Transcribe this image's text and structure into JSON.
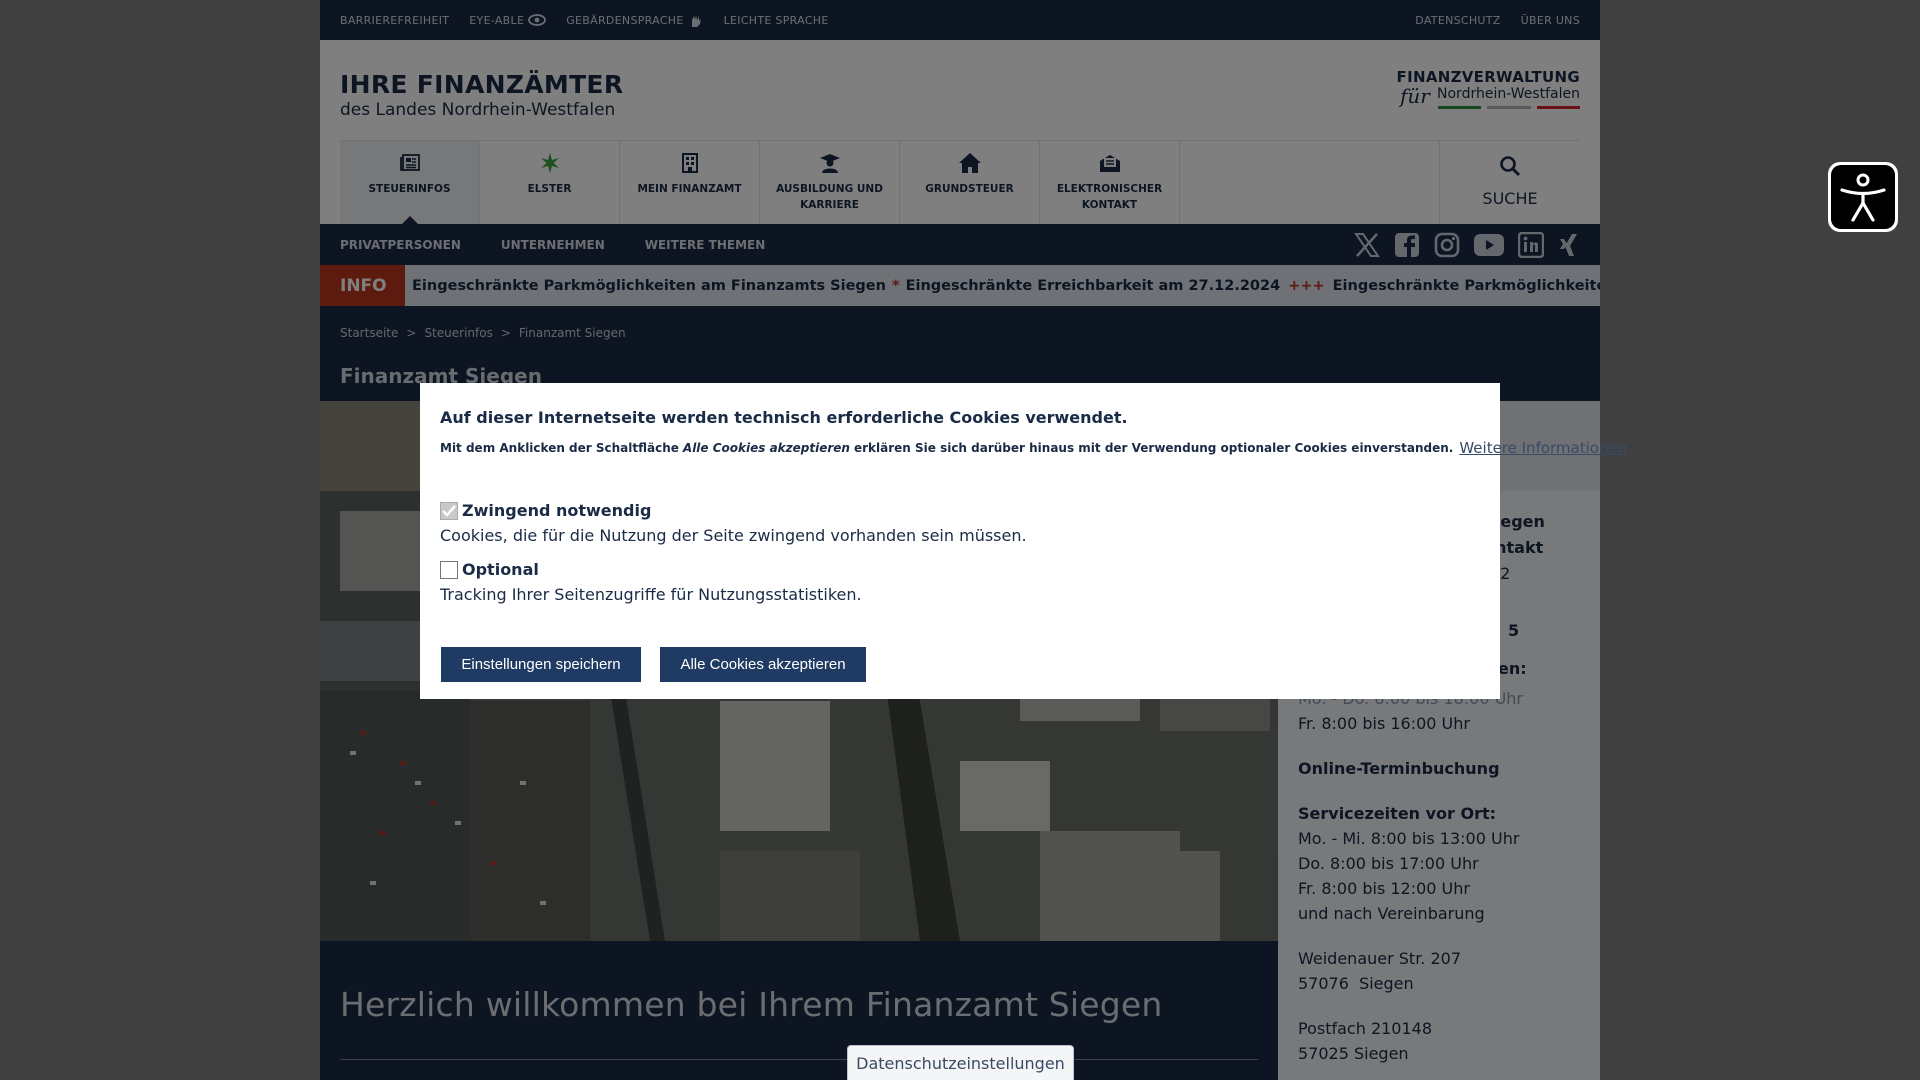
{
  "colors": {
    "navy": "#1a2b45",
    "info_red": "#b9361d",
    "button_blue": "#1f3b63",
    "overlay": "rgba(0,0,0,0.5)"
  },
  "topbar": {
    "left": [
      {
        "label": "BARRIEREFREIHEIT"
      },
      {
        "label": "EYE-ABLE",
        "icon": "eye-icon"
      },
      {
        "label": "GEBÄRDENSPRACHE",
        "icon": "hand-sign-icon"
      },
      {
        "label": "LEICHTE SPRACHE"
      }
    ],
    "right": [
      {
        "label": "DATENSCHUTZ"
      },
      {
        "label": "ÜBER UNS"
      }
    ]
  },
  "header": {
    "title": "IHRE FINANZÄMTER",
    "subtitle": "des Landes Nordrhein-Westfalen",
    "logo_line1": "FINANZVERWALTUNG",
    "logo_fuer": "für",
    "logo_line2": "Nordrhein-Westfalen",
    "logo_stripe_colors": [
      "#2e8b3a",
      "#b0b0b0",
      "#d0202a"
    ]
  },
  "mainnav": {
    "items": [
      {
        "label": "STEUERINFOS",
        "icon": "newspaper-icon",
        "active": true
      },
      {
        "label": "ELSTER",
        "icon": "elster-star-icon"
      },
      {
        "label": "MEIN FINANZAMT",
        "icon": "building-icon"
      },
      {
        "label": "AUSBILDUNG UND KARRIERE",
        "icon": "graduate-icon"
      },
      {
        "label": "GRUNDSTEUER",
        "icon": "house-icon"
      },
      {
        "label": "ELEKTRONISCHER KONTAKT",
        "icon": "mailbox-icon"
      }
    ],
    "search": {
      "label": "SUCHE",
      "icon": "search-icon"
    }
  },
  "subnav": {
    "items": [
      "PRIVATPERSONEN",
      "UNTERNEHMEN",
      "WEITERE THEMEN"
    ],
    "social": [
      "x-icon",
      "facebook-icon",
      "instagram-icon",
      "youtube-icon",
      "linkedin-icon",
      "xing-icon"
    ]
  },
  "ticker": {
    "label": "INFO",
    "messages": [
      "Eingeschränkte Parkmöglichkeiten am Finanzamts Siegen",
      "*",
      "Eingeschränkte Erreichbarkeit am 27.12.2024",
      "+++",
      "Eingeschränkte Parkmöglichkeiten am Finanzamts Siegen",
      "*"
    ]
  },
  "breadcrumb": {
    "items": [
      "Startseite",
      "Steuerinfos",
      "Finanzamt Siegen"
    ],
    "separator": ">"
  },
  "page_title": "Finanzamt Siegen",
  "sidebar": {
    "partial_top1": "nliegen",
    "partial_top2": "Kontakt",
    "partial_top3": "42",
    "partial_top4": "5",
    "partial_top5": "en:",
    "partial_hours": "Mo. - Do. 8:00 bis 18:00 Uhr",
    "hours_fr": "Fr. 8:00 bis 16:00 Uhr",
    "online_booking": "Online-Terminbuchung",
    "service_title": "Servicezeiten vor Ort:",
    "service_lines": [
      "Mo. - Mi. 8:00 bis 13:00 Uhr",
      "Do. 8:00 bis 17:00 Uhr",
      "Fr. 8:00 bis 12:00 Uhr",
      "und nach Vereinbarung"
    ],
    "address": [
      "Weidenauer Str. 207",
      "57076  Siegen"
    ],
    "postbox": [
      "Postfach 210148",
      "57025 Siegen"
    ]
  },
  "welcome": {
    "heading": "Herzlich willkommen bei Ihrem Finanzamt Siegen"
  },
  "cookie_modal": {
    "heading": "Auf dieser Internetseite werden technisch erforderliche Cookies verwendet.",
    "text_before": "Mit dem Anklicken der Schaltfläche",
    "text_em": "Alle Cookies akzeptieren",
    "text_after": "erklären Sie sich darüber hinaus mit der Verwendung optionaler Cookies einverstanden.",
    "more_link": "Weitere Informationen",
    "options": [
      {
        "label": "Zwingend notwendig",
        "description": "Cookies, die für die Nutzung der Seite zwingend vorhanden sein müssen.",
        "checked": true,
        "disabled": true
      },
      {
        "label": "Optional",
        "description": "Tracking Ihrer Seitenzugriffe für Nutzungsstatistiken.",
        "checked": false,
        "disabled": false
      }
    ],
    "save_button": "Einstellungen speichern",
    "accept_all_button": "Alle Cookies akzeptieren"
  },
  "privacy_tab": "Datenschutzeinstellungen",
  "a11y_button": {
    "icon": "accessibility-person-icon"
  }
}
